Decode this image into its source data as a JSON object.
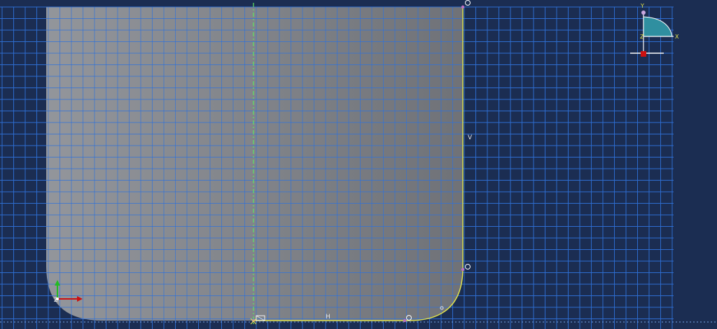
{
  "viewport": {
    "background": "#1b2d52",
    "grid_color": "#2f6fd4",
    "part_gradient": [
      "#a8a8a8",
      "#7e7e7e"
    ],
    "edge_color": "#e6e64a",
    "centerline_color": "#5fe65f",
    "vertex_color": "#c070c0"
  },
  "constraints": {
    "vertical": "V",
    "horizontal": "H"
  },
  "view_triad": {
    "y_label": "Y",
    "x_label": "X",
    "z_label": "Z",
    "fill_color": "#2f8fa0",
    "origin_color": "#cc1111"
  },
  "origin_triad": {
    "z_label": "Z",
    "x_arrow_color": "#cc1111",
    "y_arrow_color": "#22bb22"
  }
}
